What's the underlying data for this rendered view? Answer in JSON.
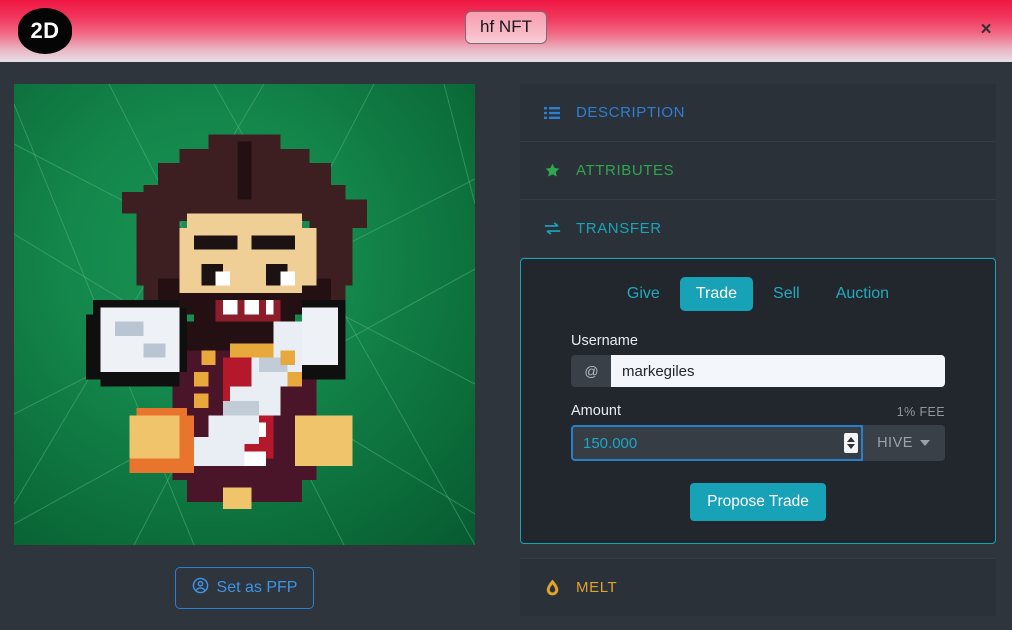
{
  "header": {
    "mode_badge": "2D",
    "title": "hf NFT",
    "close_label": "×",
    "gradient_top": "#ef1743",
    "gradient_bottom": "#e6dfe8"
  },
  "artwork": {
    "alt_name": "pixel-art-character",
    "background_color": "#0f7d44"
  },
  "left_panel": {
    "pfp_button_label": "Set as PFP",
    "pfp_icon": "user-circle-icon",
    "pfp_accent": "#3d94e8"
  },
  "accordion": {
    "sections": [
      {
        "label": "DESCRIPTION",
        "icon": "list-ul-icon",
        "color": "#2e7fd0",
        "expanded": false
      },
      {
        "label": "ATTRIBUTES",
        "icon": "star-icon",
        "color": "#2fa64f",
        "expanded": false
      },
      {
        "label": "TRANSFER",
        "icon": "exchange-icon",
        "color": "#19a4ba",
        "expanded": true
      },
      {
        "label": "MELT",
        "icon": "fire-drop-icon",
        "color": "#e0a32b",
        "expanded": false
      }
    ]
  },
  "transfer": {
    "tabs": [
      {
        "label": "Give",
        "active": false
      },
      {
        "label": "Trade",
        "active": true
      },
      {
        "label": "Sell",
        "active": false
      },
      {
        "label": "Auction",
        "active": false
      }
    ],
    "accent_color": "#17a2b8",
    "username": {
      "label": "Username",
      "prefix": "@",
      "value": "markegiles",
      "placeholder": "username"
    },
    "amount": {
      "label": "Amount",
      "fee_note": "1% FEE",
      "value": "150.000",
      "placeholder": "0.000",
      "currency": "HIVE",
      "currency_icon": "chevron-down-icon",
      "spinner_icon": "number-spinner-icon"
    },
    "submit_label": "Propose Trade"
  }
}
